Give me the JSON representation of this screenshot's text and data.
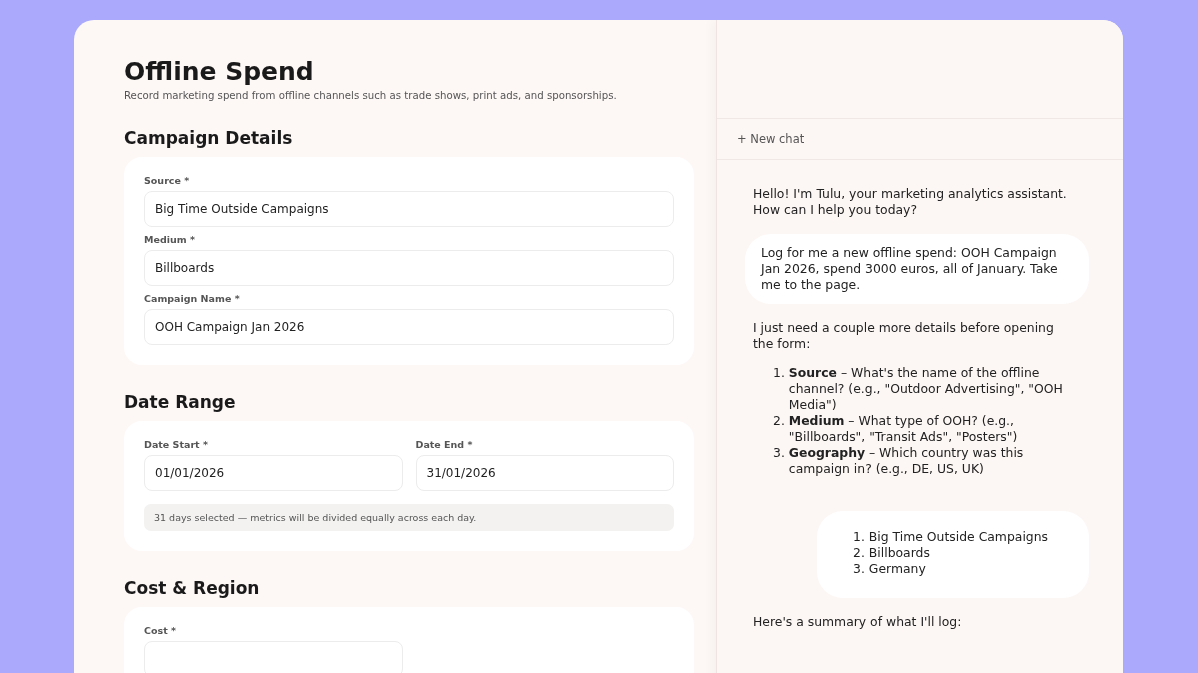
{
  "page": {
    "title": "Offline Spend",
    "subtitle": "Record marketing spend from offline channels such as trade shows, print ads, and sponsorships."
  },
  "sections": [
    {
      "title": "Campaign Details",
      "kind": "single",
      "fields": [
        {
          "label": "Source *",
          "value": "Big Time Outside Campaigns"
        },
        {
          "label": "Medium *",
          "value": "Billboards"
        },
        {
          "label": "Campaign Name *",
          "value": "OOH Campaign Jan 2026"
        }
      ]
    },
    {
      "title": "Date Range",
      "kind": "paired",
      "fields": [
        {
          "label": "Date Start *",
          "value": "01/01/2026"
        },
        {
          "label": "Date End *",
          "value": "31/01/2026"
        }
      ],
      "note": "31 days selected — metrics will be divided equally across each day."
    },
    {
      "title": "Cost & Region",
      "kind": "paired",
      "fields": [
        {
          "label": "Cost *"
        }
      ]
    }
  ],
  "chat": {
    "new_chat": "+ New chat",
    "messages": [
      {
        "kind": "plain",
        "text": "Hello! I'm Tulu, your marketing analytics assistant. How can I help you today?"
      },
      {
        "kind": "bubble",
        "text": "Log for me a new offline spend: OOH Campaign Jan 2026, spend 3000 euros, all of January. Take me to the page."
      },
      {
        "kind": "plain",
        "text": "I just need a couple more details before opening the form:",
        "list": [
          {
            "number": "1.",
            "text": "**Source** – What's the name of the offline channel? (e.g., \"Outdoor Advertising\", \"OOH Media\")"
          },
          {
            "number": "2.",
            "text": "**Medium** – What type of OOH? (e.g., \"Billboards\", \"Transit Ads\", \"Posters\")"
          },
          {
            "number": "3.",
            "text": "**Geography** – Which country was this campaign in? (e.g., DE, US, UK)"
          }
        ]
      },
      {
        "kind": "bubble",
        "list": [
          {
            "number": "1.",
            "text": "Big Time Outside Campaigns"
          },
          {
            "number": "2.",
            "text": "Billboards"
          },
          {
            "number": "3.",
            "text": "Germany"
          }
        ]
      },
      {
        "kind": "plain",
        "text": "Here's a summary of what I'll log:"
      }
    ]
  }
}
